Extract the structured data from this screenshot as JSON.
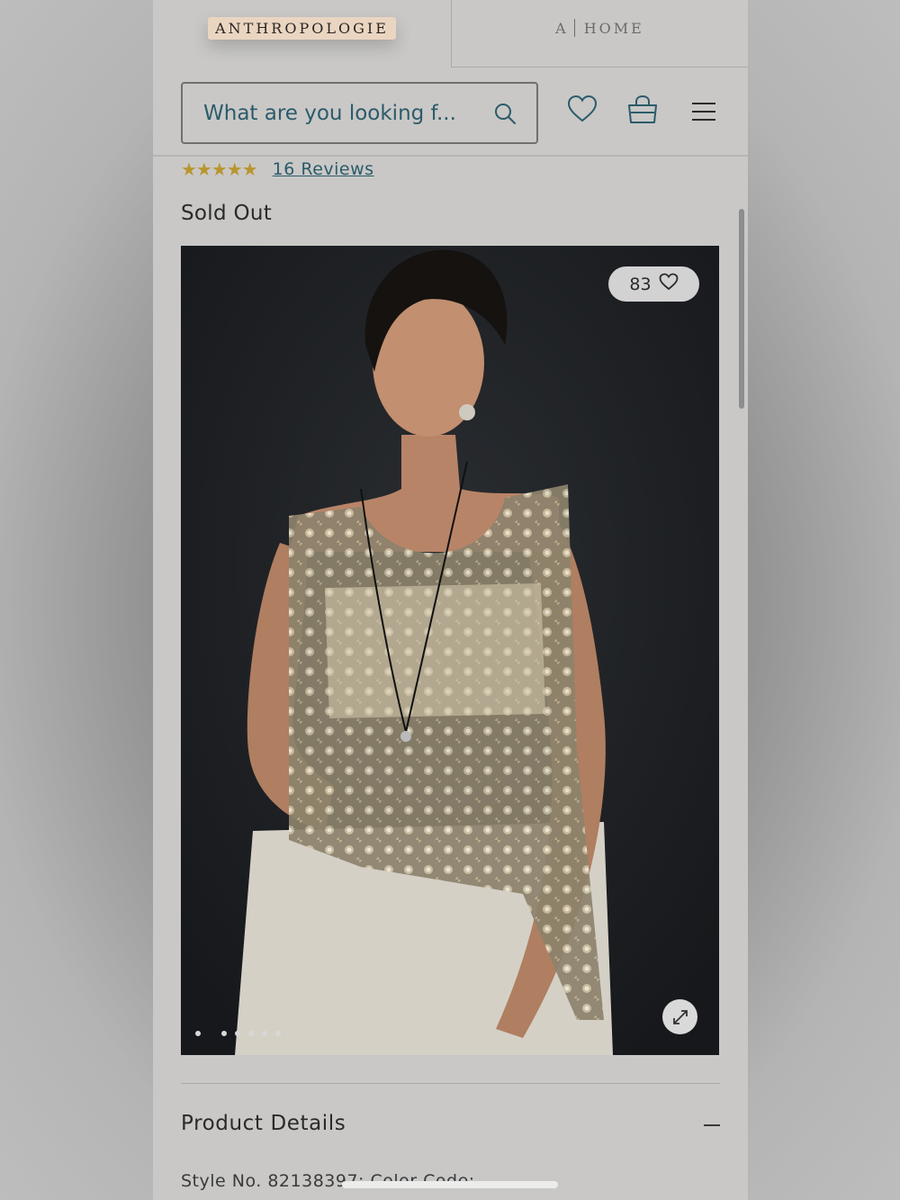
{
  "brand_tabs": {
    "anthropologie_logo": "ANTHROPOLOGIE",
    "home_tab_letter": "A",
    "home_tab_label": "HOME"
  },
  "header": {
    "search_placeholder": "What are you looking f...",
    "icons": [
      "search-icon",
      "heart-icon",
      "bag-icon",
      "menu-icon"
    ]
  },
  "product": {
    "rating_stars": "★★★★★",
    "rating_value": 4.5,
    "reviews_link": "16 Reviews",
    "availability": "Sold Out",
    "like_count": "83",
    "image_slide_count": 6,
    "active_slide": 1
  },
  "details": {
    "section_title": "Product Details",
    "style_line": "Style No. 82138397; Color Code:"
  },
  "colors": {
    "accent_teal": "#2b5b6b",
    "star_gold": "#b8962e",
    "logo_bg": "#ead5c1"
  }
}
